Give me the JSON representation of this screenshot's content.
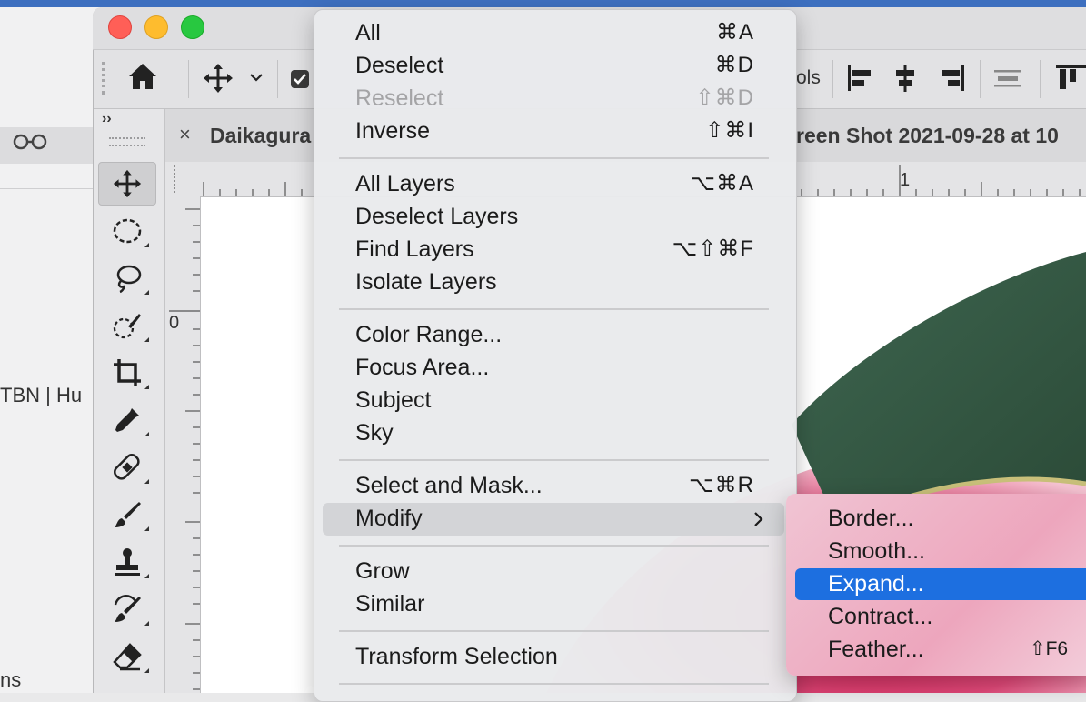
{
  "background_app": {
    "glasses_icon": "reading-list-icon",
    "sidebar_text_1": "TBN | Hu",
    "sidebar_text_2": "ns"
  },
  "photoshop": {
    "traffic_lights": {
      "close": "#ff5f57",
      "minimize": "#febc2e",
      "zoom": "#28c840"
    },
    "options_bar": {
      "home_icon": "home-icon",
      "move_icon": "move-icon",
      "partial_label": "ols"
    },
    "tabs": {
      "tab1_close": "×",
      "tab1_title": "Daikagura",
      "tab2_title": "reen Shot 2021-09-28 at 10"
    },
    "ruler": {
      "h_mark": "1",
      "v_mark": "0"
    },
    "toolbox": {
      "collapse_label": "››",
      "tools": [
        "move-tool",
        "ellipse-marquee-tool",
        "lasso-tool",
        "quick-selection-tool",
        "crop-tool",
        "eyedropper-tool",
        "healing-brush-tool",
        "brush-tool",
        "clone-stamp-tool",
        "history-brush-tool",
        "eraser-tool"
      ]
    }
  },
  "select_menu": {
    "items": [
      {
        "label": "All",
        "shortcut": "⌘A"
      },
      {
        "label": "Deselect",
        "shortcut": "⌘D"
      },
      {
        "label": "Reselect",
        "shortcut": "⇧⌘D",
        "disabled": true
      },
      {
        "label": "Inverse",
        "shortcut": "⇧⌘I"
      },
      {
        "label": "All Layers",
        "shortcut": "⌥⌘A"
      },
      {
        "label": "Deselect Layers",
        "shortcut": ""
      },
      {
        "label": "Find Layers",
        "shortcut": "⌥⇧⌘F"
      },
      {
        "label": "Isolate Layers",
        "shortcut": ""
      },
      {
        "label": "Color Range...",
        "shortcut": ""
      },
      {
        "label": "Focus Area...",
        "shortcut": ""
      },
      {
        "label": "Subject",
        "shortcut": ""
      },
      {
        "label": "Sky",
        "shortcut": ""
      },
      {
        "label": "Select and Mask...",
        "shortcut": "⌥⌘R"
      },
      {
        "label": "Modify",
        "shortcut": "›"
      },
      {
        "label": "Grow",
        "shortcut": ""
      },
      {
        "label": "Similar",
        "shortcut": ""
      },
      {
        "label": "Transform Selection",
        "shortcut": ""
      }
    ]
  },
  "modify_submenu": {
    "items": [
      {
        "label": "Border...",
        "shortcut": ""
      },
      {
        "label": "Smooth...",
        "shortcut": ""
      },
      {
        "label": "Expand...",
        "shortcut": ""
      },
      {
        "label": "Contract...",
        "shortcut": ""
      },
      {
        "label": "Feather...",
        "shortcut": "⇧F6"
      }
    ],
    "highlight_color": "#1d6fe0"
  }
}
